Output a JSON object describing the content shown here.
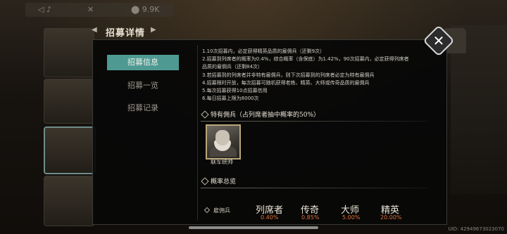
{
  "background": {
    "topbar_items": [
      "◁ ♪",
      "✕",
      "⬤ 9.9K"
    ]
  },
  "header": {
    "title": "招募详情"
  },
  "tabs": [
    {
      "label": "招募信息",
      "active": true
    },
    {
      "label": "招募一览",
      "active": false
    },
    {
      "label": "招募记录",
      "active": false
    }
  ],
  "rules": [
    "1.10次招募内，必定获得精英品质的雇佣兵（还剩9次）",
    "2.招募到列席者的概率为0.4%，综合概率（含保底）为1.42%，90次招募内，必定获得列席者",
    "品质的雇佣兵（还剩84次）",
    "3.若招募到的列席者并非特有雇佣兵，则下次招募到的列席者必定为特有雇佣兵",
    "4.招募限时开放，每次招募可随机获得老练、精英、大师或传奇品质的雇佣兵",
    "5.每次招募获得10点招募信用",
    "6.每日招募上限为8000次"
  ],
  "special_section": {
    "title": "特有佣兵（占列席者抽中概率的50%）",
    "mercenary_name": "联军统帅"
  },
  "overview_section": {
    "title": "概率总览",
    "row_label": "雇佣兵",
    "rarities": [
      {
        "name": "列席者",
        "rate": "0.40%"
      },
      {
        "name": "传奇",
        "rate": "0.85%"
      },
      {
        "name": "大师",
        "rate": "5.00%"
      },
      {
        "name": "精英",
        "rate": "20.00%"
      }
    ]
  },
  "footer": {
    "uid": "UID: 4294967302307​0"
  },
  "colors": {
    "active_tab": "#4e9a92",
    "rate_text": "#e0703a",
    "card_border": "#b9a77b"
  }
}
